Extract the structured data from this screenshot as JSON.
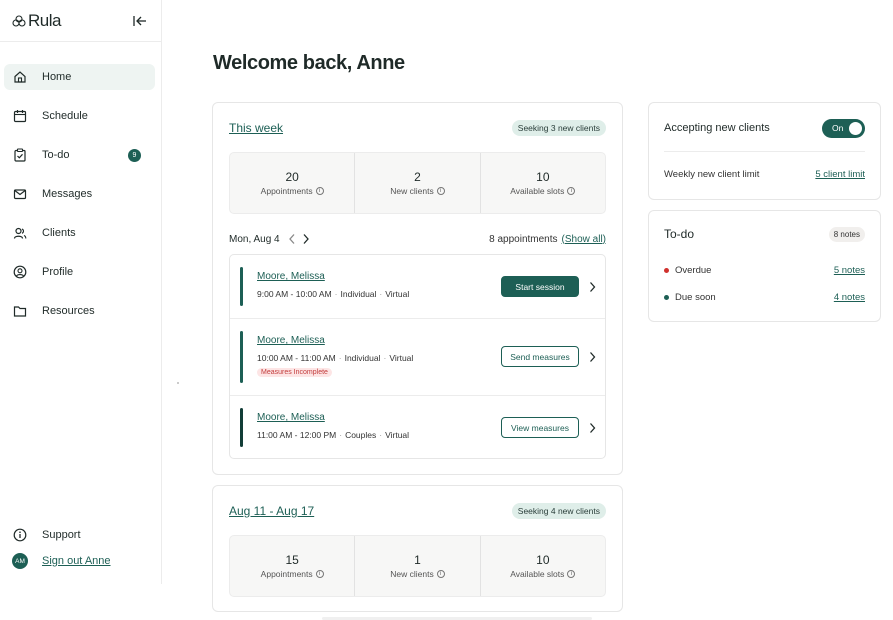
{
  "brand": {
    "name": "Rula"
  },
  "sidebar": {
    "items": [
      {
        "label": "Home",
        "icon": "home-icon",
        "active": true
      },
      {
        "label": "Schedule",
        "icon": "calendar-icon"
      },
      {
        "label": "To-do",
        "icon": "clipboard-check-icon",
        "badge": "9"
      },
      {
        "label": "Messages",
        "icon": "mail-icon"
      },
      {
        "label": "Clients",
        "icon": "users-icon"
      },
      {
        "label": "Profile",
        "icon": "user-circle-icon"
      },
      {
        "label": "Resources",
        "icon": "folder-icon"
      }
    ],
    "support_label": "Support",
    "avatar_initials": "AM",
    "signout_label": "Sign out Anne"
  },
  "main": {
    "welcome": "Welcome back, Anne"
  },
  "this_week": {
    "title": "This week",
    "seeking": "Seeking 3 new clients",
    "stats": [
      {
        "value": "20",
        "label": "Appointments"
      },
      {
        "value": "2",
        "label": "New clients"
      },
      {
        "value": "10",
        "label": "Available slots"
      }
    ],
    "day": "Mon, Aug 4",
    "appt_count": "8 appointments",
    "show_all": "(Show all)",
    "appointments": [
      {
        "name": "Moore, Melissa",
        "time": "9:00 AM - 10:00 AM",
        "type": "Individual",
        "mode": "Virtual",
        "action": "Start session",
        "tag": ""
      },
      {
        "name": "Moore, Melissa",
        "time": "10:00 AM - 11:00 AM",
        "type": "Individual",
        "mode": "Virtual",
        "action": "Send measures",
        "tag": "Measures Incomplete"
      },
      {
        "name": "Moore, Melissa",
        "time": "11:00 AM - 12:00 PM",
        "type": "Couples",
        "mode": "Virtual",
        "action": "View measures",
        "tag": ""
      }
    ]
  },
  "next_week": {
    "title": "Aug 11 - Aug 17",
    "seeking": "Seeking 4 new clients",
    "stats": [
      {
        "value": "15",
        "label": "Appointments"
      },
      {
        "value": "1",
        "label": "New clients"
      },
      {
        "value": "10",
        "label": "Available slots"
      }
    ]
  },
  "accepting": {
    "label": "Accepting new clients",
    "toggle_label": "On",
    "toggle_on": true,
    "limit_label": "Weekly new client limit",
    "limit_value": "5 client limit"
  },
  "todo": {
    "title": "To-do",
    "count": "8 notes",
    "rows": [
      {
        "label": "Overdue",
        "value": "5 notes",
        "color": "#d0312d"
      },
      {
        "label": "Due soon",
        "value": "4 notes",
        "color": "#1d5f55"
      }
    ]
  },
  "colors": {
    "primary": "#1d5f55",
    "accent_light": "#dfeee9",
    "bar_dark": "#123d37"
  }
}
